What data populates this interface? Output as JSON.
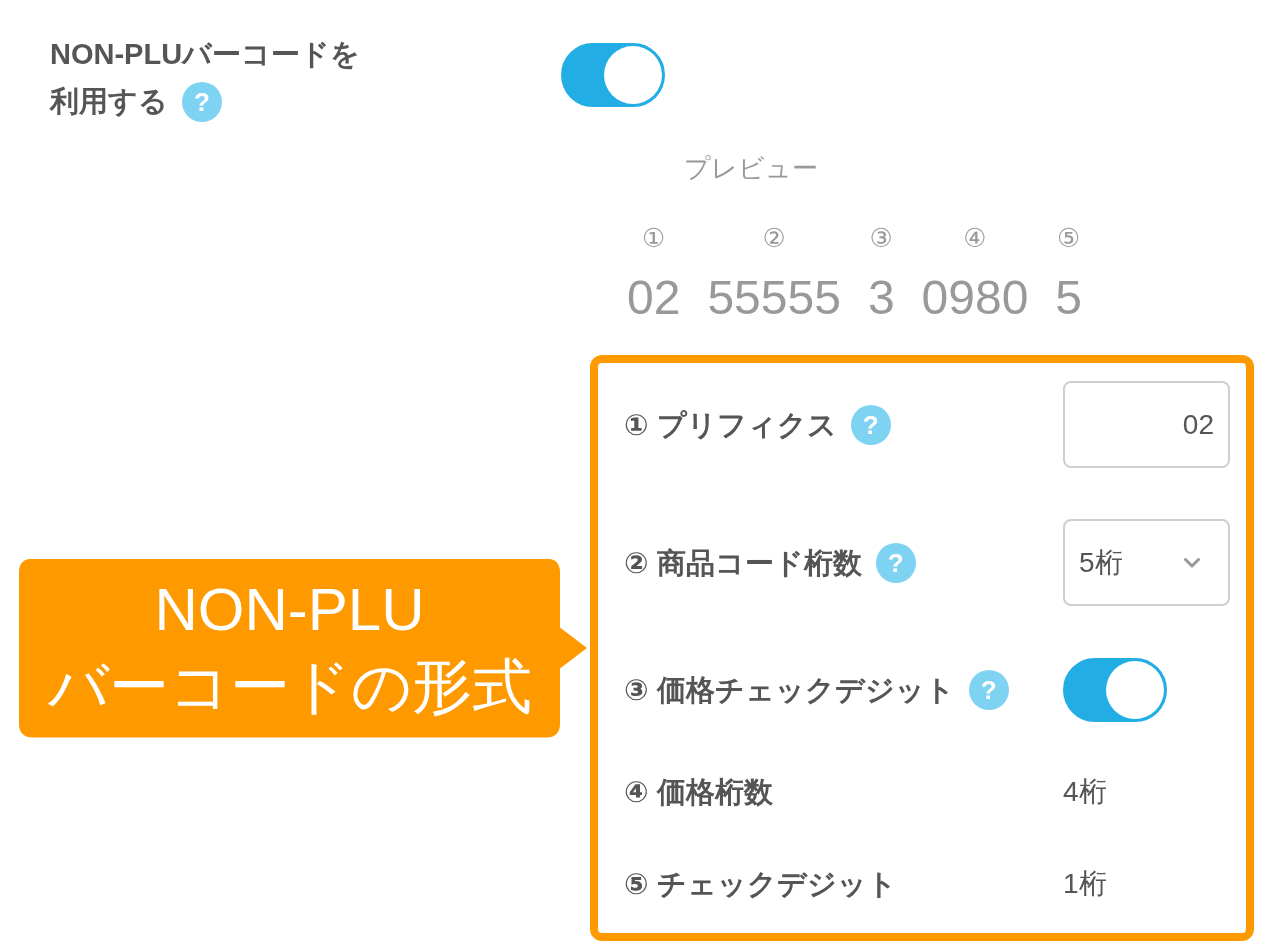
{
  "setting": {
    "label_lines": [
      "NON-PLUバーコードを",
      "利用する"
    ],
    "help": "?",
    "on": true
  },
  "preview": {
    "title": "プレビュー",
    "segments": [
      {
        "marker": "①",
        "digits": "02"
      },
      {
        "marker": "②",
        "digits": "55555"
      },
      {
        "marker": "③",
        "digits": "3"
      },
      {
        "marker": "④",
        "digits": "0980"
      },
      {
        "marker": "⑤",
        "digits": "5"
      }
    ]
  },
  "callout": {
    "lines": [
      "NON-PLU",
      "バーコードの形式"
    ]
  },
  "format_fields": [
    {
      "kind": "input",
      "label": "① プリフィクス",
      "help": "?",
      "value": "02"
    },
    {
      "kind": "select",
      "label": "② 商品コード桁数",
      "help": "?",
      "value": "5桁"
    },
    {
      "kind": "toggle",
      "label": "③ 価格チェックデジット",
      "help": "?",
      "on": true
    },
    {
      "kind": "text",
      "label": "④ 価格桁数",
      "value": "4桁"
    },
    {
      "kind": "text",
      "label": "⑤ チェックデジット",
      "value": "1桁"
    }
  ]
}
